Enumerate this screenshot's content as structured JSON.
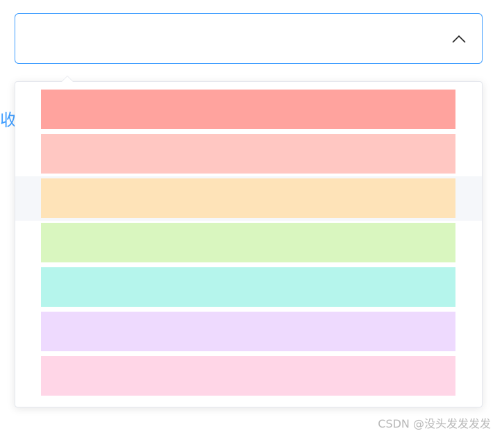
{
  "select": {
    "value": "",
    "open": true,
    "accent_color": "#409eff"
  },
  "behind_text": "收",
  "dropdown": {
    "hovered_index": 2,
    "options": [
      {
        "color": "#ffa39e"
      },
      {
        "color": "#ffc7c2"
      },
      {
        "color": "#fee3b8"
      },
      {
        "color": "#d9f6bf"
      },
      {
        "color": "#b5f5ec"
      },
      {
        "color": "#eedafe"
      },
      {
        "color": "#ffd6e7"
      }
    ]
  },
  "watermark": "CSDN @没头发发发发"
}
